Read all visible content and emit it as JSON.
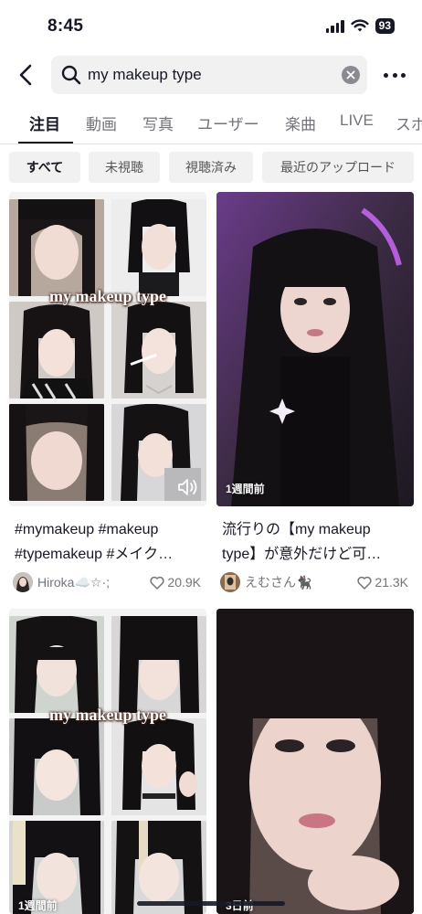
{
  "status_bar": {
    "time": "8:45",
    "battery": "93"
  },
  "search": {
    "query": "my makeup type"
  },
  "tabs": [
    {
      "label": "注目",
      "active": true
    },
    {
      "label": "動画"
    },
    {
      "label": "写真"
    },
    {
      "label": "ユーザー"
    },
    {
      "label": "楽曲"
    },
    {
      "label": "LIVE"
    },
    {
      "label": "スポ"
    }
  ],
  "filters": [
    {
      "label": "すべて",
      "active": true
    },
    {
      "label": "未視聴"
    },
    {
      "label": "視聴済み"
    },
    {
      "label": "最近のアップロード"
    }
  ],
  "results": [
    {
      "overlay_text": "my makeup type",
      "time_ago": "",
      "caption_line1": "#mymakeup #makeup",
      "caption_line2": "#typemakeup #メイク…",
      "username": "Hiroka☁️☆·;",
      "likes": "20.9K"
    },
    {
      "overlay_text": "",
      "time_ago": "1週間前",
      "caption_line1": "流行りの【my makeup",
      "caption_line2": "type】が意外だけど可…",
      "username": "えむさん🐈‍⬛",
      "likes": "21.3K"
    },
    {
      "overlay_text": "my makeup type",
      "time_ago": "1週間前"
    },
    {
      "overlay_text": "",
      "time_ago": "3日前"
    }
  ],
  "colors": {
    "text_primary": "#161823",
    "text_secondary": "#73747b",
    "chip_bg": "#f1f1f2",
    "accent_purple": "#b04ad6"
  }
}
